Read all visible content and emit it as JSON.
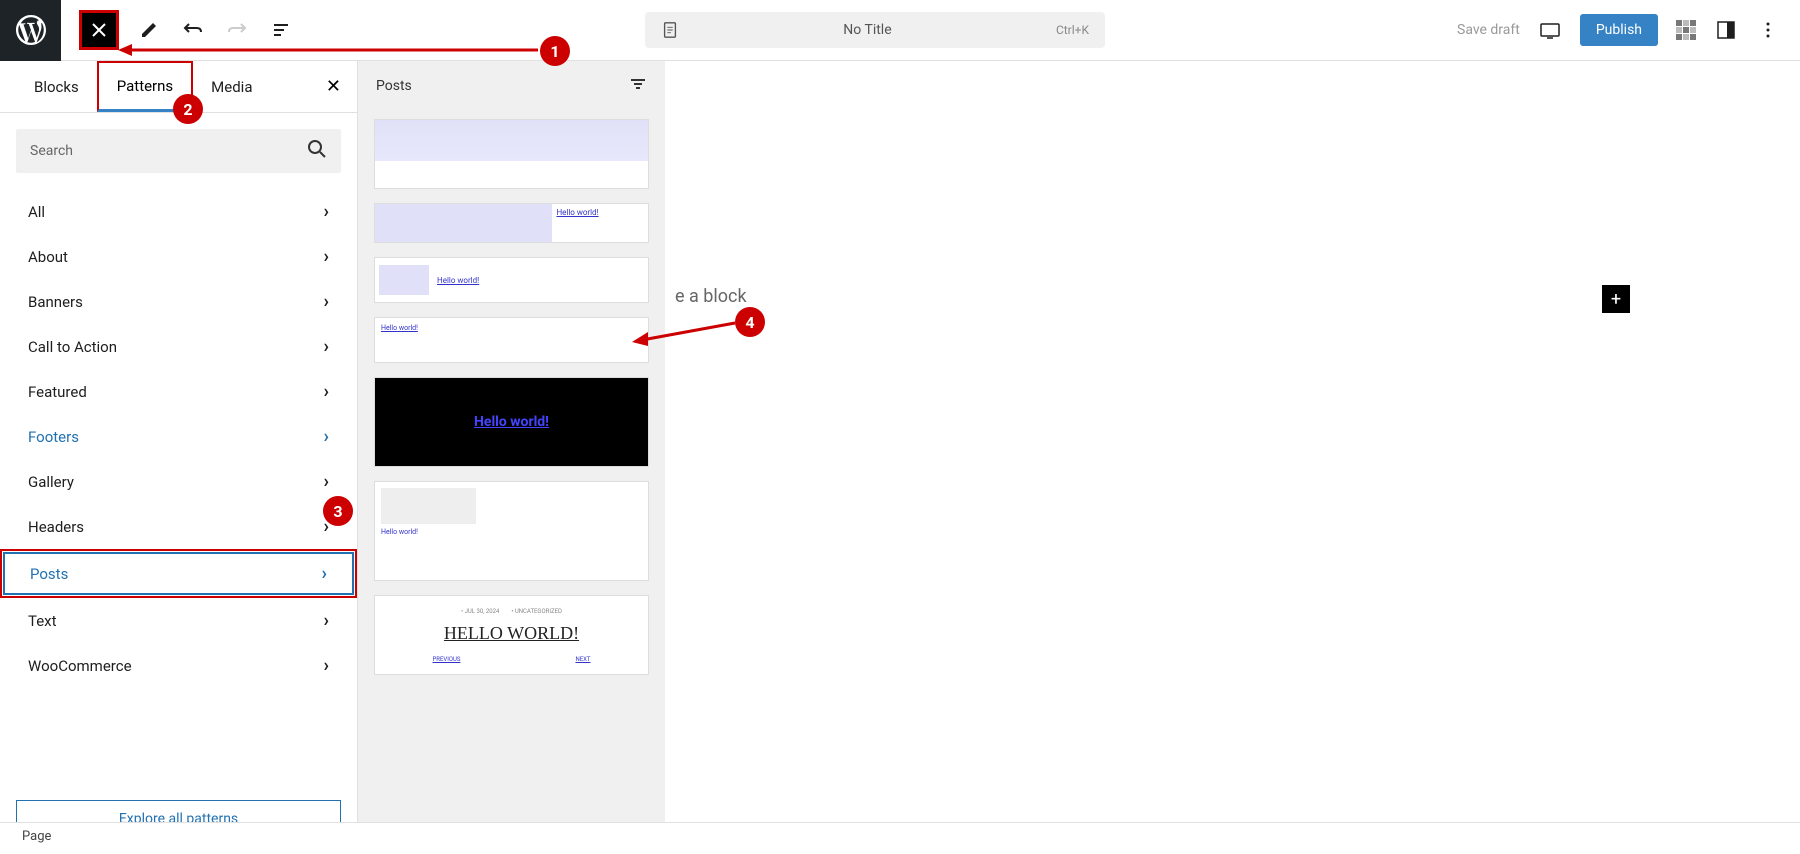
{
  "topbar": {
    "title": "No Title",
    "shortcut": "Ctrl+K",
    "save_draft": "Save draft",
    "publish": "Publish"
  },
  "tabs": {
    "blocks": "Blocks",
    "patterns": "Patterns",
    "media": "Media"
  },
  "search": {
    "placeholder": "Search"
  },
  "categories": [
    {
      "label": "All",
      "style": ""
    },
    {
      "label": "About",
      "style": ""
    },
    {
      "label": "Banners",
      "style": ""
    },
    {
      "label": "Call to Action",
      "style": ""
    },
    {
      "label": "Featured",
      "style": ""
    },
    {
      "label": "Footers",
      "style": "link"
    },
    {
      "label": "Gallery",
      "style": ""
    },
    {
      "label": "Headers",
      "style": ""
    },
    {
      "label": "Posts",
      "style": "selected"
    },
    {
      "label": "Text",
      "style": ""
    },
    {
      "label": "WooCommerce",
      "style": ""
    }
  ],
  "explore": "Explore all patterns",
  "patterns_pane": {
    "title": "Posts"
  },
  "previews": {
    "hello_u": "Hello world!",
    "hello_big": "Hello world!",
    "hello_serif": "HELLO WORLD!",
    "date_small": "• JUL 30, 2024",
    "cat_small": "• UNCATEGORIZED",
    "prev": "PREVIOUS",
    "next": "NEXT"
  },
  "canvas": {
    "placeholder": "e a block"
  },
  "footer": {
    "doc_type": "Page"
  },
  "markers": {
    "m1": "1",
    "m2": "2",
    "m3": "3",
    "m4": "4"
  }
}
